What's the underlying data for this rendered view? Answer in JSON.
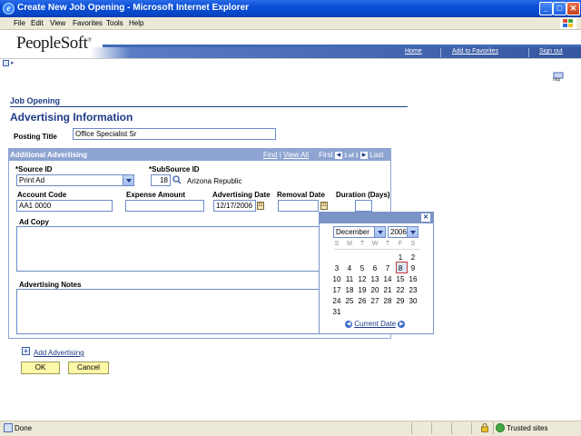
{
  "window": {
    "title": "Create New Job Opening - Microsoft Internet Explorer",
    "menu": [
      "File",
      "Edit",
      "View",
      "Favorites",
      "Tools",
      "Help"
    ],
    "min": "_",
    "max": "□",
    "close": "✕"
  },
  "header": {
    "logo": "PeopleSoft",
    "links": [
      "Home",
      "Add to Favorites",
      "Sign out"
    ],
    "help_label": "http"
  },
  "page": {
    "header": "Job Opening",
    "title": "Advertising Information",
    "posting_title_label": "Posting Title",
    "posting_title_value": "Office Specialist Sr"
  },
  "grid": {
    "title": "Additional Advertising",
    "find": "Find",
    "sep": "|",
    "view_all": "View All",
    "first": "First",
    "range": "1 of 1",
    "last": "Last",
    "source_id_label": "*Source ID",
    "source_id_value": "Print Ad",
    "subsource_id_label": "*SubSource ID",
    "subsource_id_value": "18",
    "subsource_desc": "Arizona Republic",
    "account_code_label": "Account Code",
    "account_code_value": "AA1 0000",
    "expense_amount_label": "Expense Amount",
    "expense_amount_value": "",
    "advertising_date_label": "Advertising Date",
    "advertising_date_value": "12/17/2006",
    "removal_date_label": "Removal Date",
    "removal_date_value": "",
    "duration_label": "Duration (Days)",
    "duration_value": "",
    "ad_copy_label": "Ad Copy",
    "advertising_notes_label": "Advertising Notes"
  },
  "calendar": {
    "close": "✕",
    "month": "December",
    "year": "2006",
    "dow": [
      "S",
      "M",
      "T",
      "W",
      "T",
      "F",
      "S"
    ],
    "weeks": [
      [
        "",
        "",
        "",
        "",
        "",
        "1",
        "2"
      ],
      [
        "3",
        "4",
        "5",
        "6",
        "7",
        "8",
        "9"
      ],
      [
        "10",
        "11",
        "12",
        "13",
        "14",
        "15",
        "16"
      ],
      [
        "17",
        "18",
        "19",
        "20",
        "21",
        "22",
        "23"
      ],
      [
        "24",
        "25",
        "26",
        "27",
        "28",
        "29",
        "30"
      ],
      [
        "31",
        "",
        "",
        "",
        "",
        "",
        ""
      ]
    ],
    "selected_day": "8",
    "current_date": "Current Date"
  },
  "actions": {
    "add_advertising": "Add Advertising",
    "ok": "OK",
    "cancel": "Cancel"
  },
  "status": {
    "text": "Done",
    "zone": "Trusted sites"
  }
}
